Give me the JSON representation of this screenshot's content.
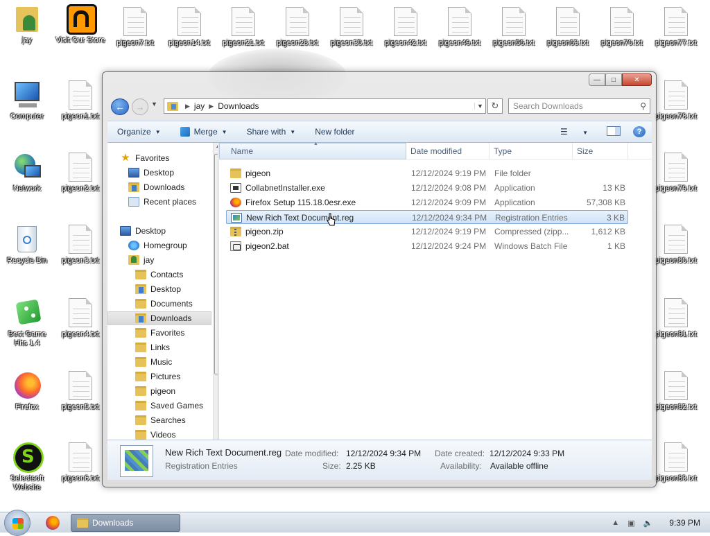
{
  "desktop": {
    "icons_left": [
      {
        "label": "jay",
        "icon": "user-folder-icon"
      },
      {
        "label": "Visit Our Store",
        "icon": "store-icon"
      },
      {
        "label": "Computer",
        "icon": "computer-icon"
      },
      {
        "label": "pigeon1.txt",
        "icon": "text-file-icon"
      },
      {
        "label": "Network",
        "icon": "network-icon"
      },
      {
        "label": "pigeon2.txt",
        "icon": "text-file-icon"
      },
      {
        "label": "Recycle Bin",
        "icon": "recycle-bin-icon"
      },
      {
        "label": "pigeon3.txt",
        "icon": "text-file-icon"
      },
      {
        "label": "Best Game Hits 1.4",
        "icon": "game-dice-icon"
      },
      {
        "label": "pigeon4.txt",
        "icon": "text-file-icon"
      },
      {
        "label": "Firefox",
        "icon": "firefox-icon"
      },
      {
        "label": "pigeon5.txt",
        "icon": "text-file-icon"
      },
      {
        "label": "Selectsoft Website",
        "icon": "selectsoft-icon"
      },
      {
        "label": "pigeon6.txt",
        "icon": "text-file-icon"
      }
    ],
    "top_row": [
      "pigeon7.txt",
      "pigeon14.txt",
      "pigeon21.txt",
      "pigeon28.txt",
      "pigeon35.txt",
      "pigeon42.txt",
      "pigeon49.txt",
      "pigeon56.txt",
      "pigeon63.txt",
      "pigeon70.txt",
      "pigeon77.txt"
    ],
    "right_col": [
      "pigeon78.txt",
      "pigeon79.txt",
      "pigeon80.txt",
      "pigeon81.txt",
      "pigeon82.txt",
      "pigeon83.txt"
    ]
  },
  "window": {
    "address": {
      "root": "jay",
      "current": "Downloads"
    },
    "search_placeholder": "Search Downloads",
    "toolbar": {
      "organize": "Organize",
      "merge": "Merge",
      "share_with": "Share with",
      "new_folder": "New folder"
    },
    "nav": {
      "favorites": "Favorites",
      "fav_items": [
        "Desktop",
        "Downloads",
        "Recent places"
      ],
      "desktop": "Desktop",
      "homegroup": "Homegroup",
      "user": "jay",
      "user_items": [
        "Contacts",
        "Desktop",
        "Documents",
        "Downloads",
        "Favorites",
        "Links",
        "Music",
        "Pictures",
        "pigeon",
        "Saved Games",
        "Searches",
        "Videos"
      ]
    },
    "columns": {
      "name": "Name",
      "date": "Date modified",
      "type": "Type",
      "size": "Size"
    },
    "files": [
      {
        "name": "pigeon",
        "date": "12/12/2024 9:19 PM",
        "type": "File folder",
        "size": "",
        "icon": "folder-icon"
      },
      {
        "name": "CollabnetInstaller.exe",
        "date": "12/12/2024 9:08 PM",
        "type": "Application",
        "size": "13 KB",
        "icon": "exe-icon"
      },
      {
        "name": "Firefox Setup 115.18.0esr.exe",
        "date": "12/12/2024 9:09 PM",
        "type": "Application",
        "size": "57,308 KB",
        "icon": "firefox-icon"
      },
      {
        "name": "New Rich Text Document.reg",
        "date": "12/12/2024 9:34 PM",
        "type": "Registration Entries",
        "size": "3 KB",
        "icon": "registry-icon"
      },
      {
        "name": "pigeon.zip",
        "date": "12/12/2024 9:19 PM",
        "type": "Compressed (zipp...",
        "size": "1,612 KB",
        "icon": "zip-folder-icon"
      },
      {
        "name": "pigeon2.bat",
        "date": "12/12/2024 9:24 PM",
        "type": "Windows Batch File",
        "size": "1 KB",
        "icon": "batch-file-icon"
      }
    ],
    "details": {
      "file_name": "New Rich Text Document.reg",
      "file_type": "Registration Entries",
      "date_modified_label": "Date modified:",
      "date_modified": "12/12/2024 9:34 PM",
      "size_label": "Size:",
      "size": "2.25 KB",
      "date_created_label": "Date created:",
      "date_created": "12/12/2024 9:33 PM",
      "availability_label": "Availability:",
      "availability": "Available offline"
    }
  },
  "taskbar": {
    "task_label": "Downloads",
    "clock": "9:39 PM"
  }
}
